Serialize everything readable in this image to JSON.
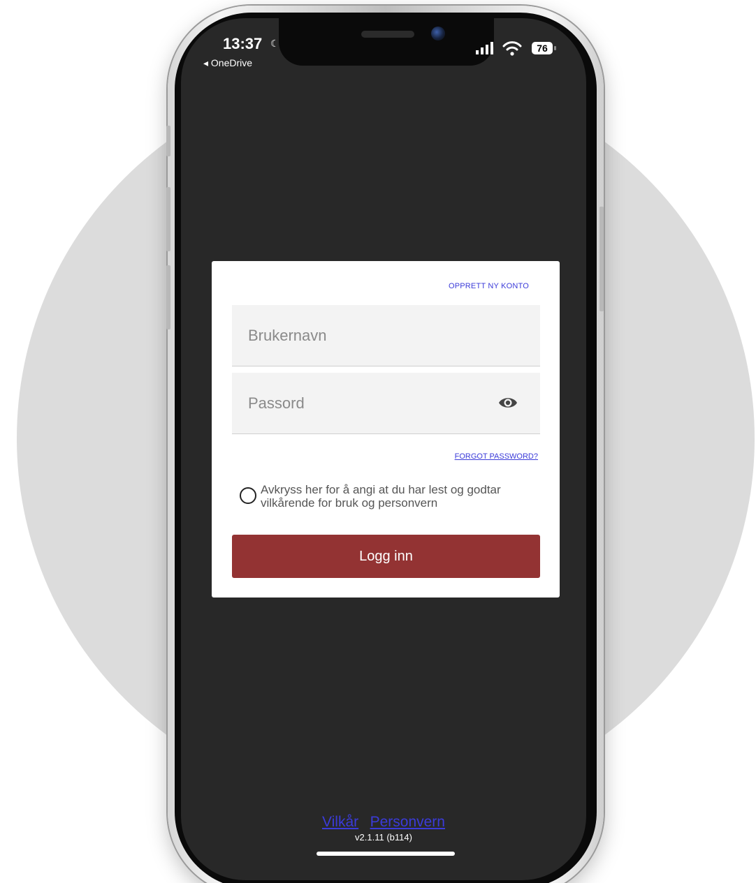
{
  "status_bar": {
    "time": "13:37",
    "back_app": "◂ OneDrive",
    "battery": "76"
  },
  "login_card": {
    "create_account_link": "OPPRETT NY KONTO",
    "username_placeholder": "Brukernavn",
    "password_placeholder": "Passord",
    "forgot_password_link": "FORGOT PASSWORD?",
    "consent_text": "Avkryss her for å angi at du har lest og godtar vilkårende for bruk og personvern",
    "login_button": "Logg inn"
  },
  "footer": {
    "terms_link": "Vilkår",
    "privacy_link": "Personvern",
    "version": "v2.1.11 (b114)"
  },
  "colors": {
    "screen_background": "#282828",
    "card_background": "#ffffff",
    "login_button": "#933333",
    "link": "#3b3bd9",
    "backdrop_circle": "#dcdcdc"
  }
}
